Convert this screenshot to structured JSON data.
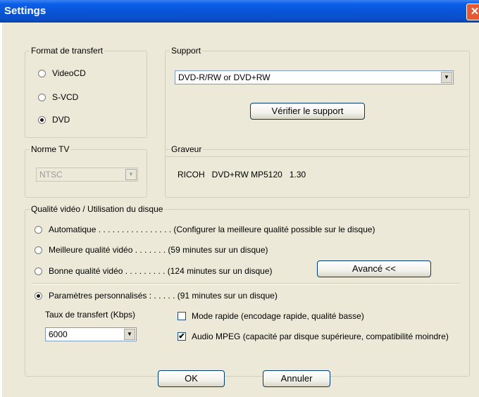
{
  "window": {
    "title": "Settings"
  },
  "format": {
    "legend": "Format de transfert",
    "options": [
      {
        "label": "VideoCD",
        "checked": false
      },
      {
        "label": "S-VCD",
        "checked": false
      },
      {
        "label": "DVD",
        "checked": true
      }
    ]
  },
  "support": {
    "legend": "Support",
    "selected": "DVD-R/RW or DVD+RW",
    "verify_button": "Vérifier le support"
  },
  "tv": {
    "legend": "Norme TV",
    "selected": "NTSC",
    "disabled": true
  },
  "burner": {
    "legend": "Graveur",
    "name": "RICOH   DVD+RW MP5120   1.30"
  },
  "quality": {
    "legend": "Qualité vidéo / Utilisation du disque",
    "options": [
      {
        "label": "Automatique . . . . . . . . . . . . . . . . (Configurer la meilleure qualité possible sur le disque)",
        "checked": false
      },
      {
        "label": "Meilleure qualité vidéo . . . . . . . (59 minutes sur un disque)",
        "checked": false
      },
      {
        "label": "Bonne qualité vidéo . . . . . . . . . (124 minutes sur un disque)",
        "checked": false
      },
      {
        "label": "Paramètres personnalisés : . . . . . (91 minutes sur un disque)",
        "checked": true
      }
    ],
    "advanced_button": "Avancé <<",
    "bitrate_label": "Taux de transfert (Kbps)",
    "bitrate_value": "6000",
    "fast_mode": {
      "label": "Mode rapide (encodage rapide, qualité basse)",
      "checked": false
    },
    "mpeg_audio": {
      "label": "Audio MPEG (capacité par disque supérieure, compatibilité moindre)",
      "checked": true
    }
  },
  "buttons": {
    "ok": "OK",
    "cancel": "Annuler"
  }
}
